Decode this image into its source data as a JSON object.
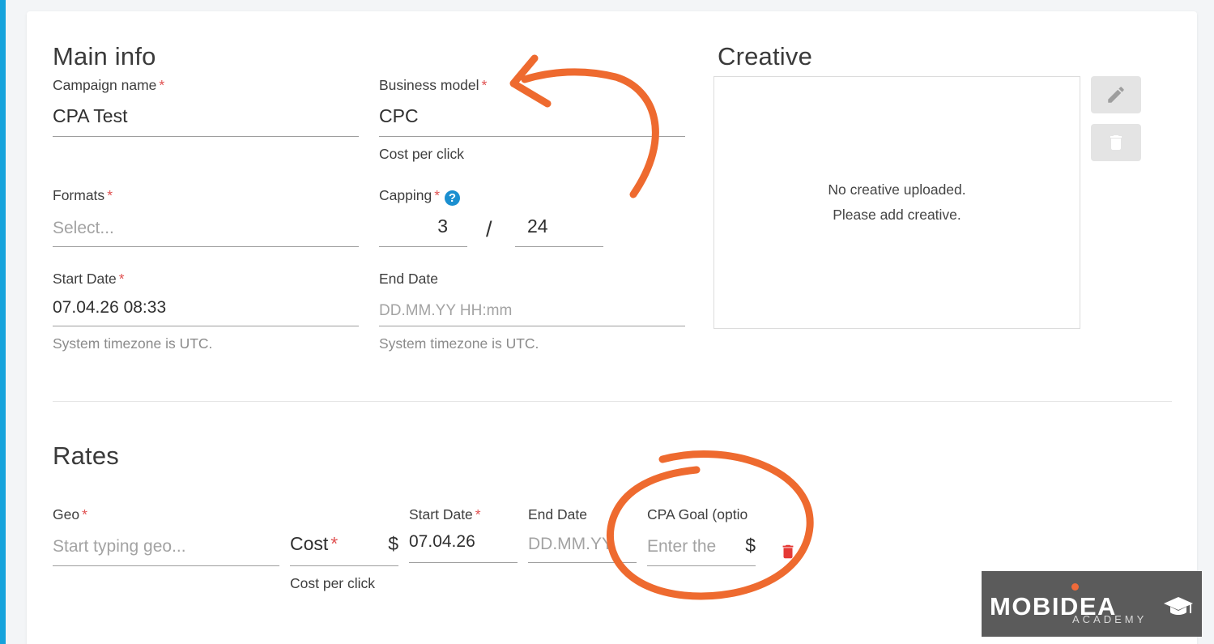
{
  "main_info": {
    "title": "Main info",
    "campaign_name": {
      "label": "Campaign name",
      "required": "*",
      "value": "CPA Test"
    },
    "business_model": {
      "label": "Business model",
      "required": "*",
      "value": "CPC",
      "hint": "Cost per click"
    },
    "formats": {
      "label": "Formats",
      "required": "*",
      "placeholder": "Select..."
    },
    "capping": {
      "label": "Capping",
      "required": "*",
      "help": "?",
      "count": "3",
      "separator": "/",
      "hours": "24"
    },
    "start_date": {
      "label": "Start Date",
      "required": "*",
      "value": "07.04.26 08:33",
      "hint": "System timezone is UTC."
    },
    "end_date": {
      "label": "End Date",
      "placeholder": "DD.MM.YY HH:mm",
      "hint": "System timezone is UTC."
    }
  },
  "creative": {
    "title": "Creative",
    "empty_line1": "No creative uploaded.",
    "empty_line2": "Please add creative."
  },
  "rates": {
    "title": "Rates",
    "geo": {
      "label": "Geo",
      "required": "*",
      "placeholder": "Start typing geo..."
    },
    "cost": {
      "label": "Cost",
      "required": "*",
      "currency": "$",
      "hint": "Cost per click"
    },
    "start_date": {
      "label": "Start Date",
      "required": "*",
      "value": "07.04.26"
    },
    "end_date": {
      "label": "End Date",
      "placeholder": "DD.MM.YY"
    },
    "cpa_goal": {
      "label": "CPA Goal (optio",
      "placeholder": "Enter the",
      "currency": "$"
    }
  },
  "watermark": {
    "brand": "MOBIDEA",
    "sub": "ACADEMY"
  },
  "colors": {
    "accent": "#15a3dc",
    "required": "#e05252",
    "annotation": "#ee6a2f",
    "delete": "#e53935"
  }
}
